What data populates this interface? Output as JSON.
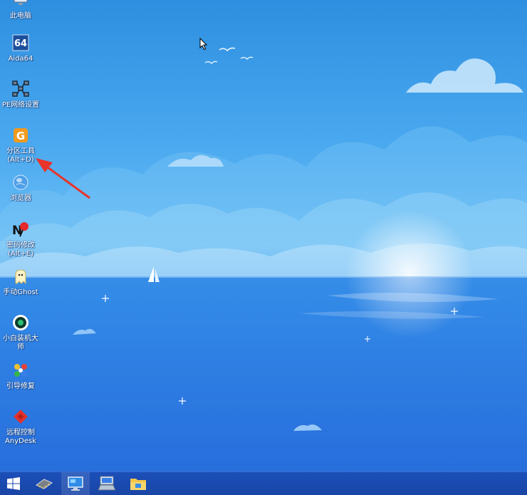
{
  "desktop_icons": [
    {
      "name": "this-pc",
      "label": "此电脑",
      "icon": "computer-icon"
    },
    {
      "name": "aida64",
      "label": "Aida64",
      "icon": "aida64-icon"
    },
    {
      "name": "pe-network",
      "label": "PE网络设置",
      "icon": "network-icon"
    },
    {
      "name": "partition-tool",
      "label": "分区工具\n(Alt+D)",
      "icon": "partition-tool-icon"
    },
    {
      "name": "browser",
      "label": "浏览器",
      "icon": "globe-icon"
    },
    {
      "name": "password-change",
      "label": "密码修改\n(Alt+E)",
      "icon": "password-icon"
    },
    {
      "name": "manual-ghost",
      "label": "手动Ghost",
      "icon": "ghost-icon"
    },
    {
      "name": "xiaobai",
      "label": "小白装机大师",
      "icon": "xiaobai-icon"
    },
    {
      "name": "boot-repair",
      "label": "引导修复",
      "icon": "boot-repair-icon"
    },
    {
      "name": "anydesk",
      "label": "远程控制\nAnyDesk",
      "icon": "anydesk-icon"
    }
  ],
  "taskbar": {
    "items": [
      {
        "name": "start-button",
        "icon": "windows-logo-icon"
      },
      {
        "name": "taskbar-hardware",
        "icon": "memory-chip-icon"
      },
      {
        "name": "taskbar-monitor",
        "icon": "monitor-icon"
      },
      {
        "name": "taskbar-keyboard",
        "icon": "keyboard-icon"
      },
      {
        "name": "taskbar-explorer",
        "icon": "folder-icon"
      }
    ]
  },
  "colors": {
    "arrow": "#e8342a",
    "taskbar": "#1b4fb8"
  }
}
